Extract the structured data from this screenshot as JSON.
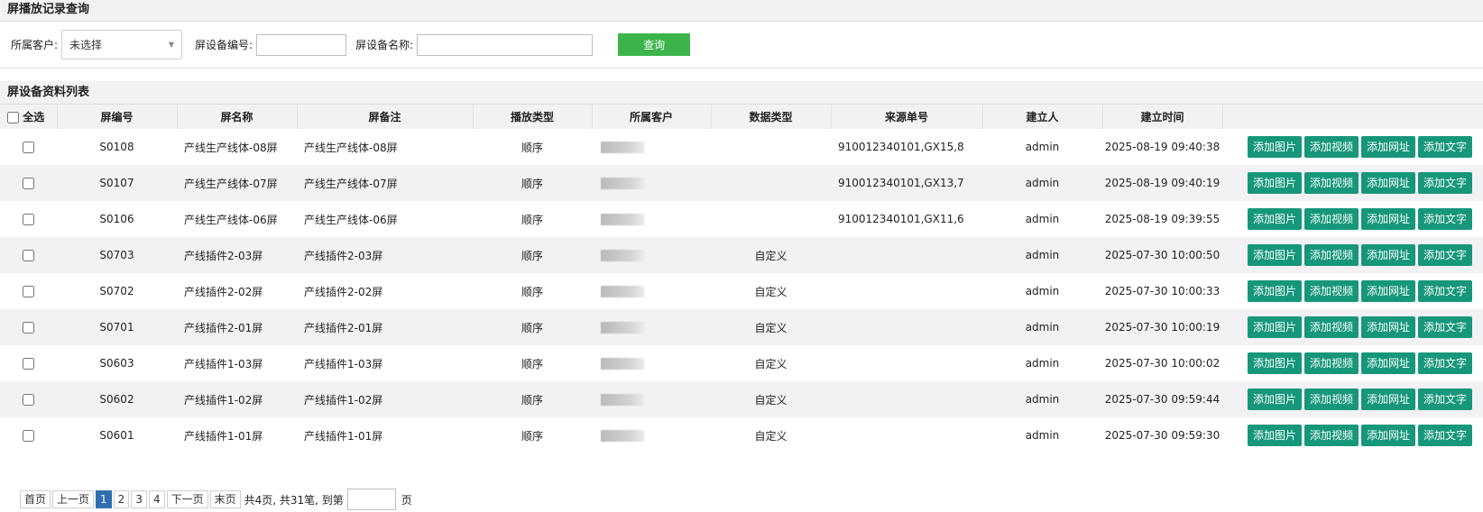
{
  "page_title": "屏播放记录查询",
  "search": {
    "customer_label": "所属客户:",
    "customer_value": "未选择",
    "device_no_label": "屏设备编号:",
    "device_no_value": "",
    "device_name_label": "屏设备名称:",
    "device_name_value": "",
    "query_button": "查询"
  },
  "list_title": "屏设备资料列表",
  "table": {
    "select_all": "全选",
    "headers": [
      "屏编号",
      "屏名称",
      "屏备注",
      "播放类型",
      "所属客户",
      "数据类型",
      "来源单号",
      "建立人",
      "建立时间"
    ],
    "rows": [
      {
        "no": "S0108",
        "name": "产线生产线体-08屏",
        "note": "产线生产线体-08屏",
        "play": "顺序",
        "dtype": "",
        "src": "910012340101,GX15,8",
        "creator": "admin",
        "time": "2025-08-19 09:40:38"
      },
      {
        "no": "S0107",
        "name": "产线生产线体-07屏",
        "note": "产线生产线体-07屏",
        "play": "顺序",
        "dtype": "",
        "src": "910012340101,GX13,7",
        "creator": "admin",
        "time": "2025-08-19 09:40:19"
      },
      {
        "no": "S0106",
        "name": "产线生产线体-06屏",
        "note": "产线生产线体-06屏",
        "play": "顺序",
        "dtype": "",
        "src": "910012340101,GX11,6",
        "creator": "admin",
        "time": "2025-08-19 09:39:55"
      },
      {
        "no": "S0703",
        "name": "产线插件2-03屏",
        "note": "产线插件2-03屏",
        "play": "顺序",
        "dtype": "自定义",
        "src": "",
        "creator": "admin",
        "time": "2025-07-30 10:00:50"
      },
      {
        "no": "S0702",
        "name": "产线插件2-02屏",
        "note": "产线插件2-02屏",
        "play": "顺序",
        "dtype": "自定义",
        "src": "",
        "creator": "admin",
        "time": "2025-07-30 10:00:33"
      },
      {
        "no": "S0701",
        "name": "产线插件2-01屏",
        "note": "产线插件2-01屏",
        "play": "顺序",
        "dtype": "自定义",
        "src": "",
        "creator": "admin",
        "time": "2025-07-30 10:00:19"
      },
      {
        "no": "S0603",
        "name": "产线插件1-03屏",
        "note": "产线插件1-03屏",
        "play": "顺序",
        "dtype": "自定义",
        "src": "",
        "creator": "admin",
        "time": "2025-07-30 10:00:02"
      },
      {
        "no": "S0602",
        "name": "产线插件1-02屏",
        "note": "产线插件1-02屏",
        "play": "顺序",
        "dtype": "自定义",
        "src": "",
        "creator": "admin",
        "time": "2025-07-30 09:59:44"
      },
      {
        "no": "S0601",
        "name": "产线插件1-01屏",
        "note": "产线插件1-01屏",
        "play": "顺序",
        "dtype": "自定义",
        "src": "",
        "creator": "admin",
        "time": "2025-07-30 09:59:30"
      }
    ],
    "actions": [
      "添加图片",
      "添加视频",
      "添加网址",
      "添加文字"
    ]
  },
  "pager": {
    "first": "首页",
    "prev": "上一页",
    "pages": [
      "1",
      "2",
      "3",
      "4"
    ],
    "current": "1",
    "next": "下一页",
    "last": "末页",
    "info": "共4页, 共31笔, 到第",
    "page_suffix": "页"
  },
  "colors": {
    "query_button": "#3cb44b",
    "action_button": "#16977a",
    "current_page": "#2f6fb0"
  }
}
